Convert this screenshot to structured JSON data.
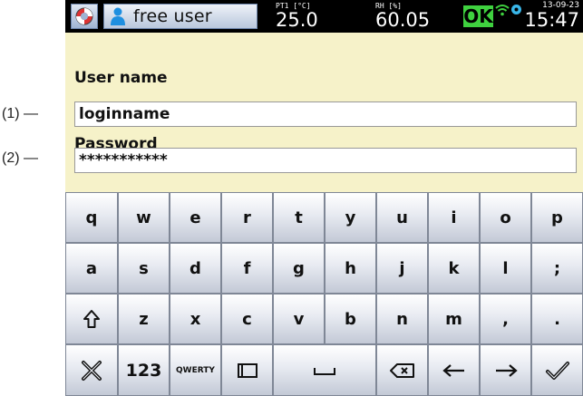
{
  "callouts": [
    "(1) —",
    "(2) —"
  ],
  "status_bar": {
    "home_icon": "lifebuoy-icon",
    "user_icon": "person-icon",
    "user_label": "free user",
    "pt1": {
      "label": "PT1 [°C]",
      "value": "25.0"
    },
    "rh": {
      "label": "RH [%]",
      "value": "60.05"
    },
    "ok_label": "OK",
    "wifi_icon": "wifi-icon",
    "gear_icon": "gear-icon",
    "date": "13-09-23",
    "time": "15:47",
    "colors": {
      "bar": "#000000",
      "ok": "#3fd13f"
    }
  },
  "form": {
    "username_label": "User name",
    "username_value": "loginname",
    "password_label": "Password",
    "password_value": "***********",
    "background": "#f6f2c9"
  },
  "keyboard": {
    "row1": [
      "q",
      "w",
      "e",
      "r",
      "t",
      "y",
      "u",
      "i",
      "o",
      "p"
    ],
    "row2": [
      "a",
      "s",
      "d",
      "f",
      "g",
      "h",
      "j",
      "k",
      "l",
      ";"
    ],
    "row3_shift_icon": "shift-icon",
    "row3": [
      "z",
      "x",
      "c",
      "v",
      "b",
      "n",
      "m",
      ",",
      "."
    ],
    "row4": {
      "cancel_icon": "close-x-icon",
      "numbers_label": "123",
      "layout_label": "QWERTY",
      "box_icon": "rectangle-icon",
      "space_icon": "space-icon",
      "backspace_icon": "backspace-icon",
      "left_icon": "arrow-left-icon",
      "right_icon": "arrow-right-icon",
      "enter_icon": "checkmark-icon"
    }
  }
}
